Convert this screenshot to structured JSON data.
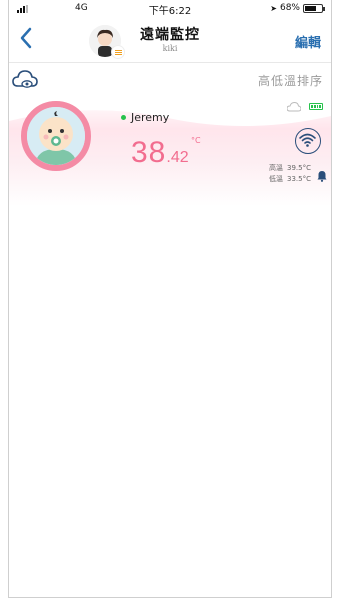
{
  "status_bar": {
    "network": "4G",
    "time": "下午6:22",
    "battery": "68%"
  },
  "nav": {
    "title": "遠端監控",
    "subtitle": "kiki",
    "edit_label": "編輯"
  },
  "toolbar": {
    "sort_label": "高低溫排序"
  },
  "device": {
    "name": "Jeremy",
    "temp_int": "38",
    "temp_dec": ".42",
    "unit": "°C",
    "high_label": "高溫",
    "high_value": "39.5°C",
    "low_label": "低溫",
    "low_value": "33.5°C"
  },
  "colors": {
    "accent_pink": "#f26d8f",
    "ring_pink": "#f48ba5",
    "link_blue": "#2a6fb0",
    "online_green": "#27c24c"
  }
}
